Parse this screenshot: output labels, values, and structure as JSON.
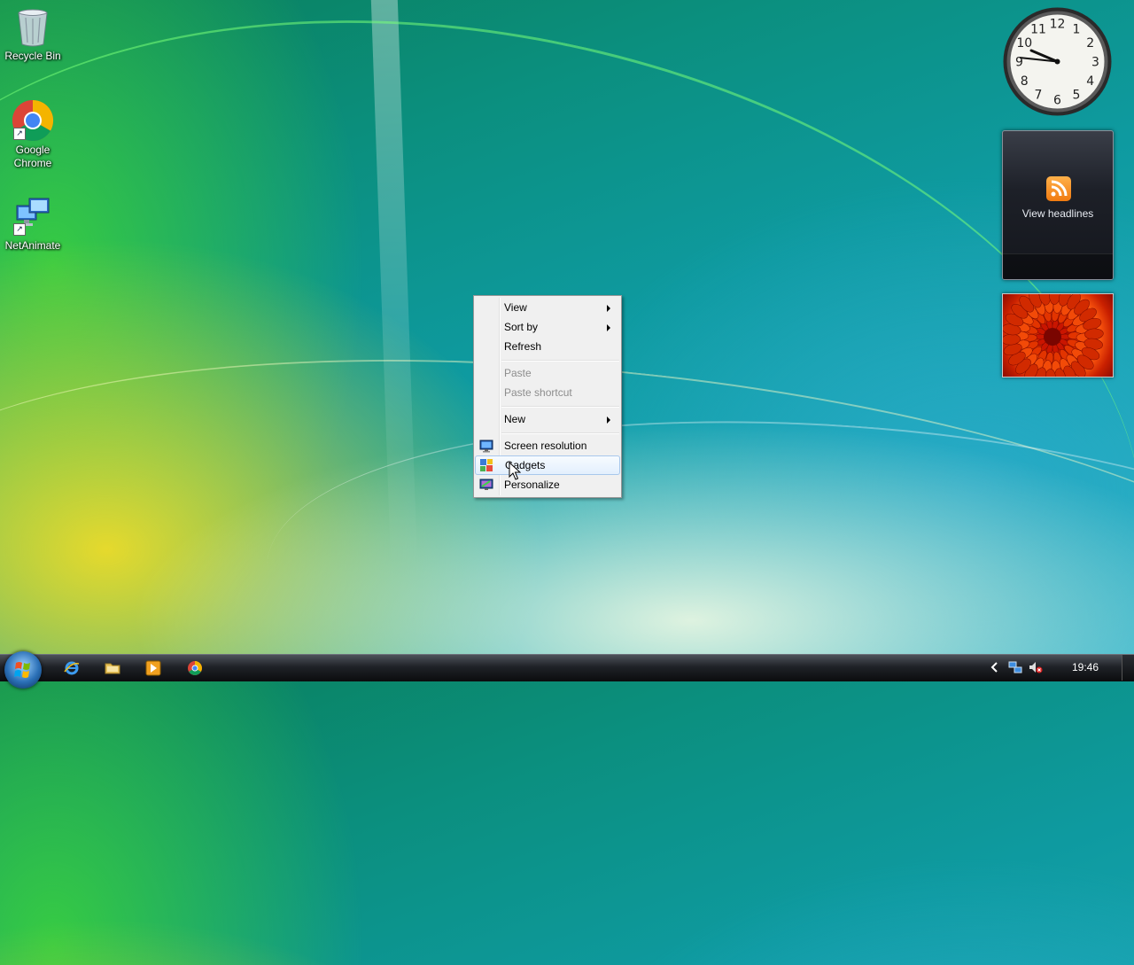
{
  "desktop": {
    "icons": [
      {
        "label": "Recycle Bin"
      },
      {
        "label": "Google Chrome"
      },
      {
        "label": "NetAnimate"
      }
    ]
  },
  "gadgets": {
    "clock": {
      "numerals": [
        "12",
        "1",
        "2",
        "3",
        "4",
        "5",
        "6",
        "7",
        "8",
        "9",
        "10",
        "11"
      ],
      "time_shown": "09:46"
    },
    "feed": {
      "label": "View headlines"
    }
  },
  "context_menu": {
    "items": [
      {
        "label": "View",
        "submenu": true,
        "enabled": true
      },
      {
        "label": "Sort by",
        "submenu": true,
        "enabled": true
      },
      {
        "label": "Refresh",
        "enabled": true
      },
      {
        "label": "Paste",
        "enabled": false
      },
      {
        "label": "Paste shortcut",
        "enabled": false
      },
      {
        "label": "New",
        "submenu": true,
        "enabled": true
      },
      {
        "label": "Screen resolution",
        "enabled": true,
        "icon": "monitor-icon"
      },
      {
        "label": "Gadgets",
        "enabled": true,
        "icon": "gadgets-icon",
        "highlighted": true
      },
      {
        "label": "Personalize",
        "enabled": true,
        "icon": "personalize-icon"
      }
    ]
  },
  "taskbar": {
    "pinned": [
      "internet-explorer-icon",
      "windows-explorer-icon",
      "media-player-icon",
      "chrome-icon"
    ],
    "tray": [
      "show-hidden-icons-chevron",
      "network-icon",
      "volume-muted-icon"
    ],
    "clock": "19:46"
  }
}
